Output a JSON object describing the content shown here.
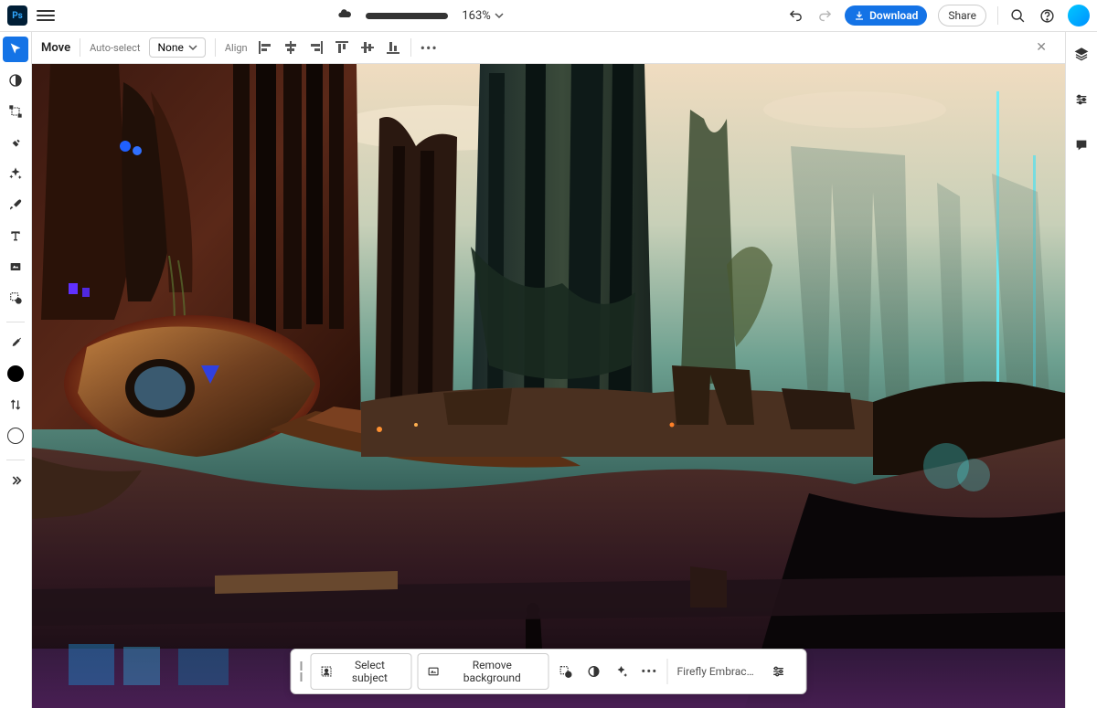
{
  "header": {
    "zoom": "163%",
    "download": "Download",
    "share": "Share"
  },
  "options": {
    "tool_name": "Move",
    "auto_select": "Auto-select",
    "select_value": "None",
    "align_label": "Align"
  },
  "taskbar": {
    "select_subject": "Select subject",
    "remove_background": "Remove background",
    "prompt": "Firefly Embrace ..."
  },
  "tools": [
    "move",
    "contrast",
    "transform",
    "heal",
    "sparkle",
    "brush",
    "text",
    "fill",
    "quick-select"
  ]
}
